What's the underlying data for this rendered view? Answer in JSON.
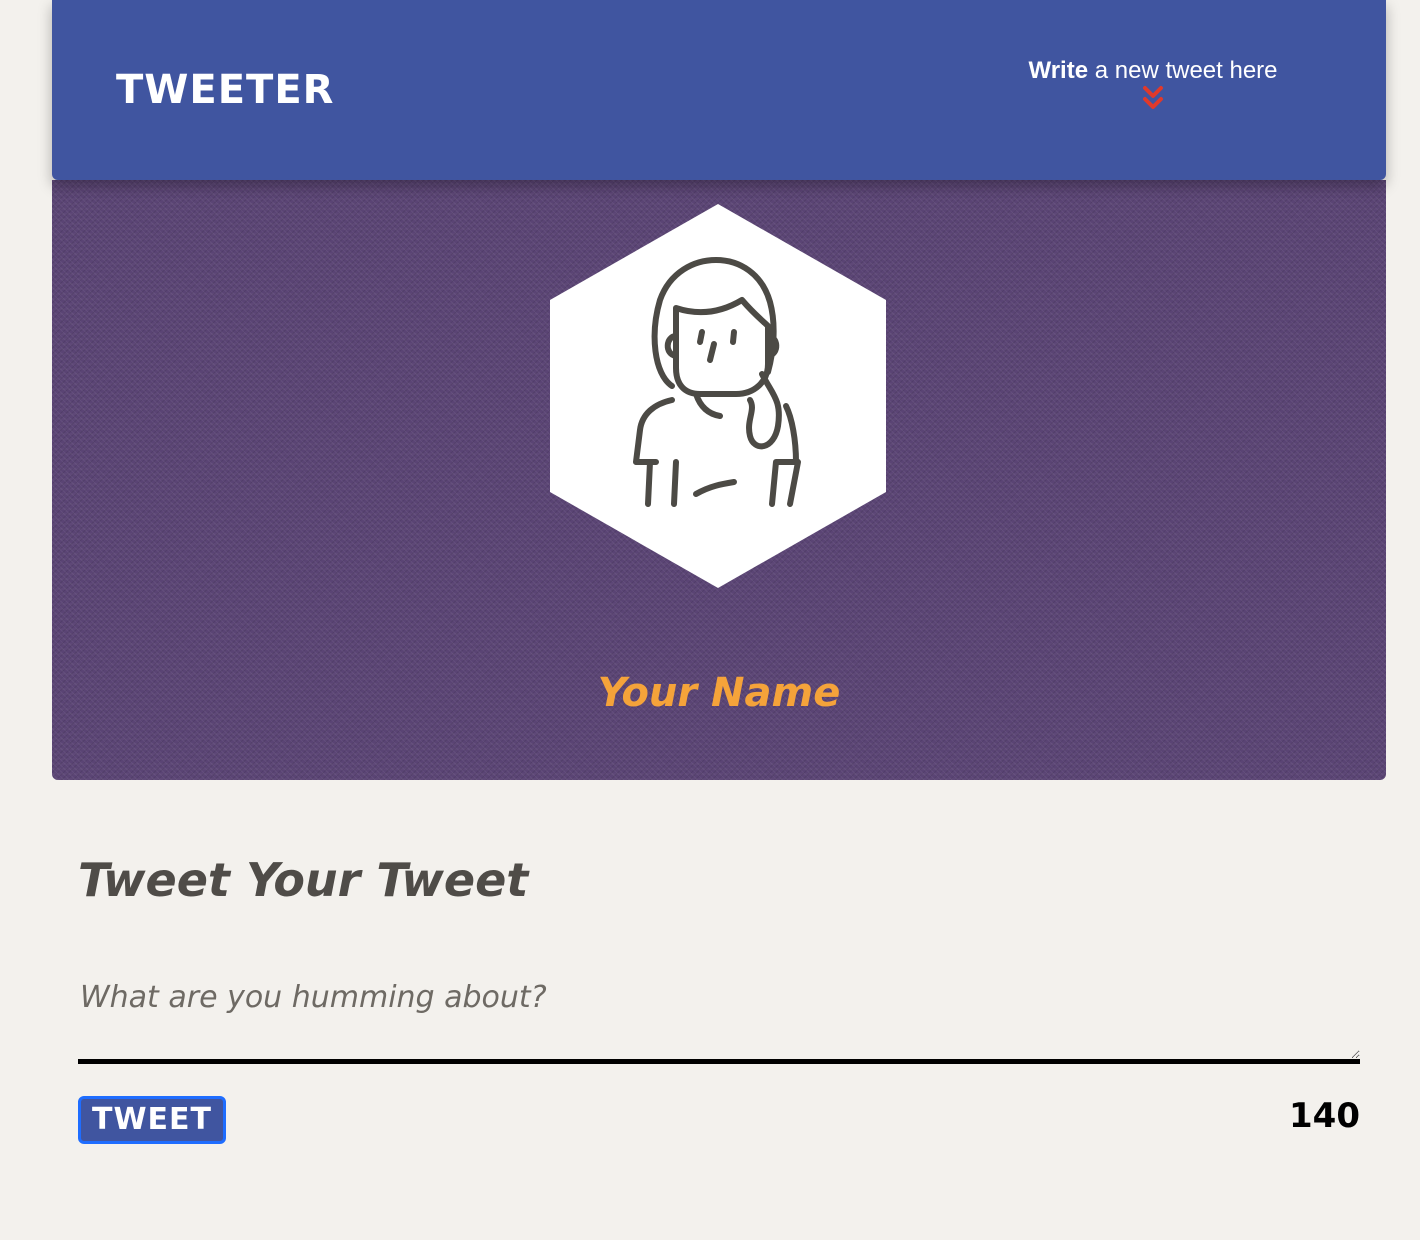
{
  "nav": {
    "brand": "TWEETER",
    "compose_toggle": {
      "bold": "Write",
      "rest": " a new tweet here",
      "icon": "double-chevron-down-icon",
      "icon_color": "#e0392b"
    }
  },
  "profile": {
    "avatar_icon": "female-user-avatar-icon",
    "name": "Your Name",
    "name_color": "#f5a33a"
  },
  "compose": {
    "heading": "Tweet Your Tweet",
    "placeholder": "What are you humming about?",
    "value": "",
    "button_label": "TWEET",
    "counter": "140"
  },
  "colors": {
    "nav_background": "#4055a0",
    "profile_background": "#5a4474",
    "page_background": "#f3f1ed",
    "button_border": "#1e6dff"
  }
}
